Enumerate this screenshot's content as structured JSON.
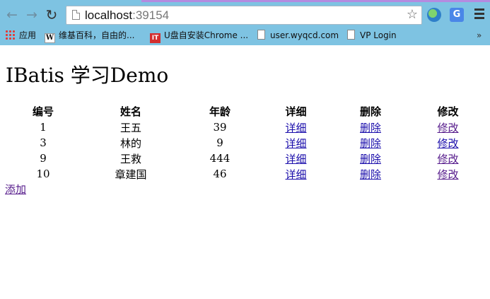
{
  "browser": {
    "url_host": "localhost",
    "url_port": ":39154",
    "ext_translate_label": "G",
    "bookmarks": [
      {
        "label": "应用",
        "icon": "apps-icon"
      },
      {
        "label": "维基百科，自由的...",
        "icon": "wikipedia-icon"
      },
      {
        "label": "U盘自安装Chrome ...",
        "icon": "it-icon"
      },
      {
        "label": "user.wyqcd.com",
        "icon": "page-icon"
      },
      {
        "label": "VP Login",
        "icon": "page-icon"
      }
    ],
    "bookmarks_more": "»"
  },
  "page": {
    "title": "IBatis 学习Demo",
    "table": {
      "headers": [
        "编号",
        "姓名",
        "年龄",
        "详细",
        "删除",
        "修改"
      ],
      "rows": [
        {
          "id": "1",
          "name": "王五",
          "age": "39",
          "detail": "详细",
          "delete": "删除",
          "edit": "修改"
        },
        {
          "id": "3",
          "name": "林的",
          "age": "9",
          "detail": "详细",
          "delete": "删除",
          "edit": "修改"
        },
        {
          "id": "9",
          "name": "王救",
          "age": "444",
          "detail": "详细",
          "delete": "删除",
          "edit": "修改"
        },
        {
          "id": "10",
          "name": "章建国",
          "age": "46",
          "detail": "详细",
          "delete": "删除",
          "edit": "修改"
        }
      ]
    },
    "add_label": "添加"
  }
}
